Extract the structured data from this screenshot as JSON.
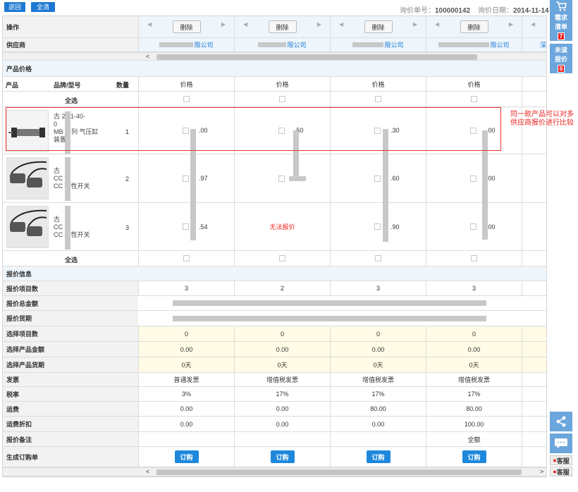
{
  "topbar": {
    "back_label": "返回",
    "clear_label": "全清",
    "inquiry_no_label": "询价单号：",
    "inquiry_no": "100000142",
    "inquiry_date_label": "询价日期：",
    "inquiry_date": "2014-11-14"
  },
  "labels": {
    "operation": "操作",
    "supplier": "供应商",
    "product_price": "产品价格",
    "product": "产品",
    "brand_model": "品牌/型号",
    "quantity": "数量",
    "select_all": "全选",
    "quote_info": "报价信息",
    "quote_items": "报价项目数",
    "quote_total": "报价总金额",
    "quote_delivery": "报价货期",
    "sel_items": "选择项目数",
    "sel_amount": "选择产品金额",
    "sel_delivery": "选择产品货期",
    "invoice": "发票",
    "tax_rate": "税率",
    "freight": "运费",
    "freight_discount": "运费折扣",
    "quote_remark": "报价备注",
    "create_order": "生成订购单"
  },
  "columns": [
    {
      "delete": "删除",
      "supplier": "限公司",
      "price_header": "价格",
      "prices": [
        ".00",
        ".97",
        ".54"
      ],
      "quote_items": "3",
      "sel_items": "0",
      "sel_amount": "0.00",
      "sel_delivery": "0天",
      "invoice": "普通发票",
      "tax": "3%",
      "freight": "0.00",
      "discount": "0.00",
      "remark": "",
      "buy": "订购"
    },
    {
      "delete": "删除",
      "supplier": "限公司",
      "price_header": "价格",
      "prices": ".50",
      "prices_list": [
        ".50",
        "",
        "无法报价"
      ],
      "quote_items": "2",
      "sel_items": "0",
      "sel_amount": "0.00",
      "sel_delivery": "0天",
      "invoice": "增值税发票",
      "tax": "17%",
      "freight": "0.00",
      "discount": "0.00",
      "remark": "",
      "buy": "订购"
    },
    {
      "delete": "删除",
      "supplier": "限公司",
      "price_header": "价格",
      "prices": [
        ".30",
        ".60",
        ".90"
      ],
      "quote_items": "3",
      "sel_items": "0",
      "sel_amount": "0.00",
      "sel_delivery": "0天",
      "invoice": "增值税发票",
      "tax": "17%",
      "freight": "80.00",
      "discount": "0.00",
      "remark": "",
      "buy": "订购"
    },
    {
      "delete": "删除",
      "supplier": "限公司",
      "price_header": "价格",
      "prices": [
        ".00",
        ".00",
        ".00"
      ],
      "quote_items": "3",
      "sel_items": "0",
      "sel_amount": "0.00",
      "sel_delivery": "0天",
      "invoice": "增值税发票",
      "tax": "17%",
      "freight": "80.00",
      "discount": "100.00",
      "remark": "全额",
      "buy": "订购"
    }
  ],
  "extra_supplier": "深",
  "products": [
    {
      "no": "1",
      "desc1": "2-11-40-",
      "desc2": "0",
      "desc3": "系列 气压缸",
      "desc4": "装置"
    },
    {
      "no": "2",
      "desc1": "",
      "desc2": "",
      "desc3": "磁性开关",
      "desc4": ""
    },
    {
      "no": "3",
      "desc1": "",
      "desc2": "",
      "desc3": "磁性开关",
      "desc4": ""
    }
  ],
  "unable_quote": "无法报价",
  "note": "同一款产品可以对多供应商报价进行比较",
  "sidebar": {
    "cart_label1": "需求",
    "cart_label2": "清单",
    "cart_count": "7",
    "unread_label1": "未读",
    "unread_label2": "报价",
    "unread_count": "0",
    "service1": "客服",
    "service2": "客服"
  },
  "colors": {
    "accent": "#1e78d2",
    "note_red": "#e22"
  }
}
